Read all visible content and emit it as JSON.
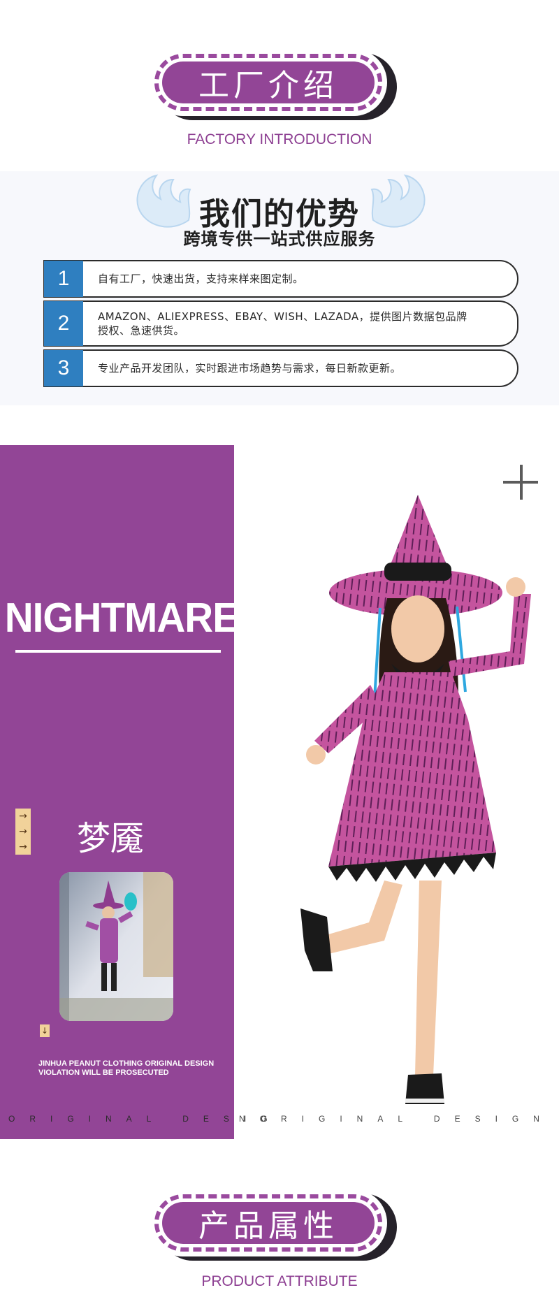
{
  "factory": {
    "title": "工厂介绍",
    "subtitle": "FACTORY INTRODUCTION"
  },
  "advantages": {
    "title": "我们的优势",
    "subtitle": "跨境专供一站式供应服务",
    "items": [
      {
        "num": "1",
        "text": "自有工厂，快速出货，支持来样来图定制。"
      },
      {
        "num": "2",
        "text": "AMAZON、ALIEXPRESS、EBAY、WISH、LAZADA，提供图片数据包品牌授权、急速供货。"
      },
      {
        "num": "3",
        "text": "专业产品开发团队，实时跟进市场趋势与需求，每日新款更新。"
      }
    ]
  },
  "product": {
    "name_en": "NIGHTMARE",
    "name_cn": "梦魇",
    "copyright_line1": "JINHUA PEANUT CLOTHING ORIGINAL DESIGN",
    "copyright_line2": "VIOLATION WILL BE PROSECUTED",
    "strip_left": "ORIGINAL DESIG",
    "strip_right": "NORIGINAL DESIGN"
  },
  "attribute": {
    "title": "产品属性",
    "subtitle": "PRODUCT ATTRIBUTE"
  },
  "colors": {
    "brand_purple": "#924596",
    "accent_blue": "#2f7fc0",
    "tag_yellow": "#f1d29a"
  }
}
